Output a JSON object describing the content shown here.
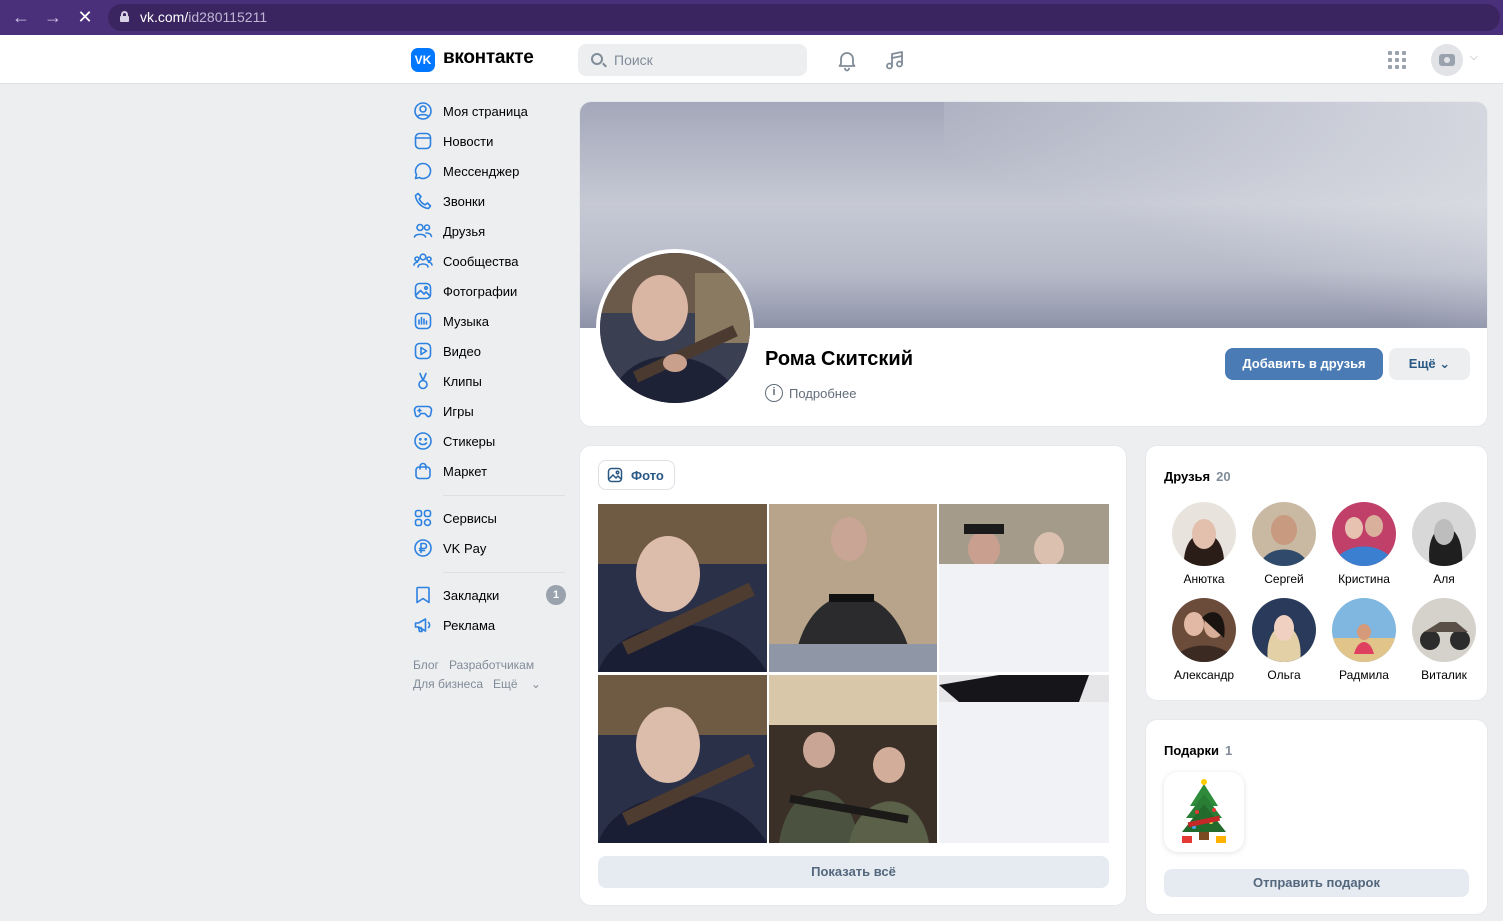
{
  "browser": {
    "url_domain": "vk.com/",
    "url_path": "id280115211"
  },
  "header": {
    "brand": "вконтакте",
    "logo_text": "VK",
    "search_placeholder": "Поиск"
  },
  "nav": {
    "items": [
      {
        "label": "Моя страница",
        "icon": "user-circle-icon"
      },
      {
        "label": "Новости",
        "icon": "newspaper-icon"
      },
      {
        "label": "Мессенджер",
        "icon": "message-icon"
      },
      {
        "label": "Звонки",
        "icon": "phone-icon"
      },
      {
        "label": "Друзья",
        "icon": "friends-icon"
      },
      {
        "label": "Сообщества",
        "icon": "community-icon"
      },
      {
        "label": "Фотографии",
        "icon": "photo-icon"
      },
      {
        "label": "Музыка",
        "icon": "music-icon"
      },
      {
        "label": "Видео",
        "icon": "video-icon"
      },
      {
        "label": "Клипы",
        "icon": "clips-icon"
      },
      {
        "label": "Игры",
        "icon": "gamepad-icon"
      },
      {
        "label": "Стикеры",
        "icon": "smile-icon"
      },
      {
        "label": "Маркет",
        "icon": "bag-icon"
      }
    ],
    "items2": [
      {
        "label": "Сервисы",
        "icon": "services-icon"
      },
      {
        "label": "VK Pay",
        "icon": "vkpay-icon"
      }
    ],
    "items3": [
      {
        "label": "Закладки",
        "icon": "bookmark-icon",
        "badge": "1"
      },
      {
        "label": "Реклама",
        "icon": "megaphone-icon"
      }
    ],
    "footer": {
      "blog": "Блог",
      "developers": "Разработчикам",
      "business": "Для бизнеса",
      "more": "Ещё"
    }
  },
  "profile": {
    "name": "Рома Скитский",
    "more_info": "Подробнее",
    "add_friend": "Добавить в друзья",
    "more_button": "Ещё"
  },
  "photos": {
    "tab_label": "Фото",
    "show_all": "Показать всё"
  },
  "friends": {
    "title": "Друзья",
    "count": "20",
    "list": [
      {
        "name": "Анютка"
      },
      {
        "name": "Сергей"
      },
      {
        "name": "Кристина"
      },
      {
        "name": "Аля"
      },
      {
        "name": "Александр"
      },
      {
        "name": "Ольга"
      },
      {
        "name": "Радмила"
      },
      {
        "name": "Виталик"
      }
    ]
  },
  "gifts": {
    "title": "Подарки",
    "count": "1",
    "send": "Отправить подарок"
  },
  "colors": {
    "browser_bar": "#4a2f7a",
    "vk_blue": "#0077ff",
    "primary_button": "#4b7bb5",
    "link": "#2a5885",
    "background": "#edeef0"
  }
}
